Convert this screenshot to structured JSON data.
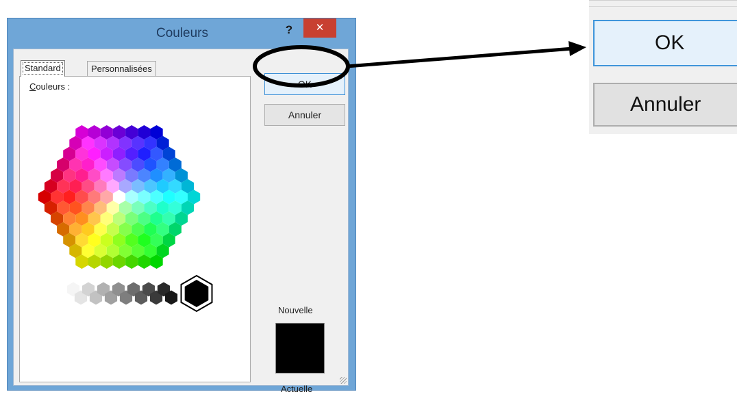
{
  "dialog": {
    "title": "Couleurs",
    "help_glyph": "?",
    "close_glyph": "✕"
  },
  "tabs": [
    {
      "label": "Standard",
      "selected": true
    },
    {
      "label": "Personnalisées",
      "selected": false
    }
  ],
  "colors_label": {
    "underlined_char": "C",
    "rest": "ouleurs :"
  },
  "buttons": {
    "ok": "OK",
    "cancel": "Annuler"
  },
  "preview": {
    "new_label": "Nouvelle",
    "current_label": "Actuelle",
    "new_color": "#000000",
    "current_color": "#000000"
  },
  "zoom": {
    "ok": "OK",
    "cancel": "Annuler"
  },
  "theme": {
    "title_bar": "#6fa6d7",
    "close_button": "#c84031",
    "ok_border": "#3c8fd6",
    "annotation": "#000000"
  },
  "icons": [
    "help-icon",
    "close-icon",
    "resize-grip-icon"
  ]
}
